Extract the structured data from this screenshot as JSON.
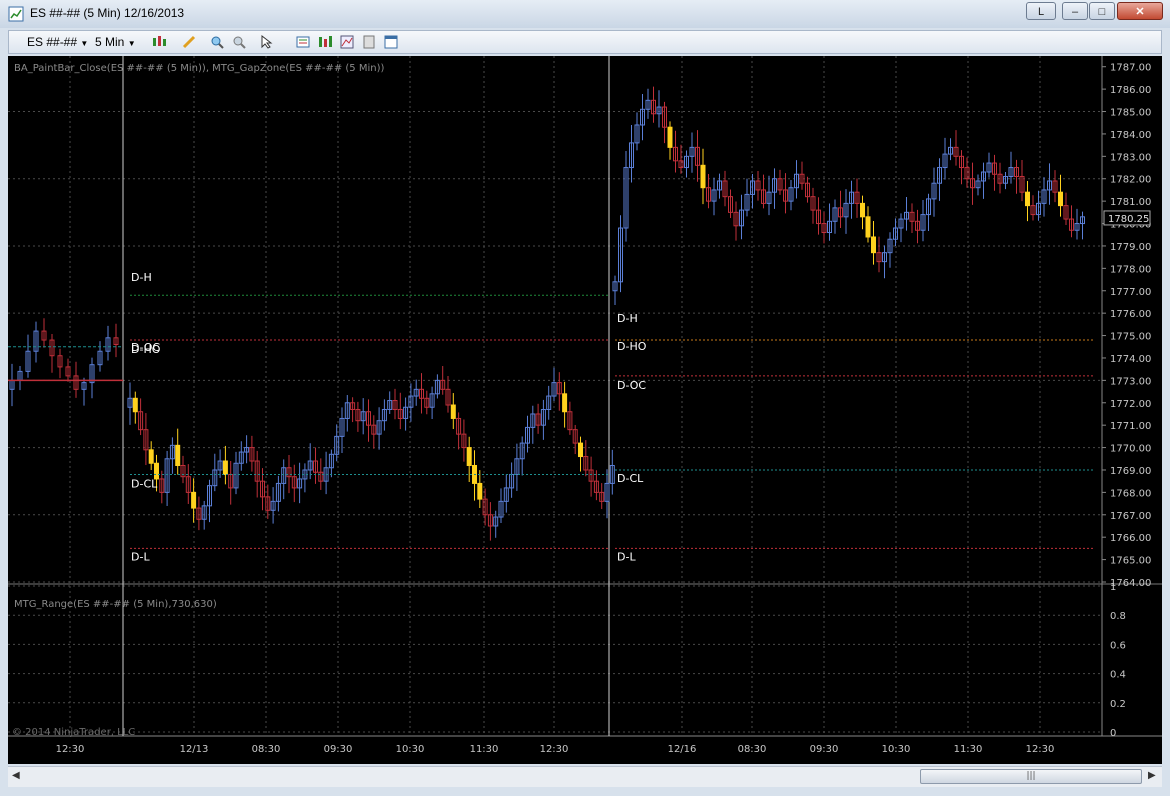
{
  "window": {
    "title": "ES ##-## (5 Min)  12/16/2013",
    "buttons": {
      "layout": "L",
      "minimize": "–",
      "maximize": "□",
      "close": "✕"
    }
  },
  "toolbar": {
    "instrument": "ES ##-##",
    "interval": "5 Min",
    "icons": [
      "candlestick-style-icon",
      "drawing-pencil-icon",
      "zoom-in-icon",
      "zoom-out-icon",
      "cursor-pointer-icon",
      "data-box-icon",
      "indicators-icon",
      "strategies-icon",
      "chart-trader-icon",
      "properties-icon"
    ]
  },
  "colors": {
    "background": "#000000",
    "grid": "#4a4a4a",
    "up_bar": "#5b7fd6",
    "down_bar": "#c0303a",
    "paint_bar": "#ffd21e",
    "doji_bar": "#ffffff",
    "zone_dh": "#1f8a3a",
    "zone_dho": "#c87a1a",
    "zone_doc": "#c0303a",
    "zone_dcl": "#1e8f8f",
    "zone_dl": "#c0303a",
    "axis_text": "#c8c8c8",
    "label_text": "#ffffff"
  },
  "price_panel": {
    "indicator_label": "BA_PaintBar_Close(ES ##-## (5 Min)),  MTG_GapZone(ES ##-## (5 Min))",
    "y_axis_ticks": [
      "1787.00",
      "1786.00",
      "1785.00",
      "1784.00",
      "1783.00",
      "1782.00",
      "1781.00",
      "1780.00",
      "1779.00",
      "1778.00",
      "1777.00",
      "1776.00",
      "1775.00",
      "1774.00",
      "1773.00",
      "1772.00",
      "1771.00",
      "1770.00",
      "1769.00",
      "1768.00",
      "1767.00",
      "1766.00",
      "1765.00",
      "1764.00"
    ],
    "last_price": "1780.25",
    "zone_labels_session1": [
      "D-H",
      "D-HO",
      "D-OC",
      "D-CL",
      "D-L"
    ],
    "zone_labels_session2": [
      "D-H",
      "D-HO",
      "D-OC",
      "D-CL",
      "D-L"
    ],
    "zones_session1": {
      "D-H": 1776.8,
      "D-HO": 1774.8,
      "D-OC": 1774.8,
      "D-CL": 1768.8,
      "D-L": 1765.5
    },
    "zones_session2": {
      "D-H": 1774.8,
      "D-HO": 1774.8,
      "D-OC": 1773.2,
      "D-CL": 1769.0,
      "D-L": 1765.5
    },
    "prior_zones": {
      "teal": 1774.5,
      "red": 1773.0
    }
  },
  "range_panel": {
    "indicator_label": "MTG_Range(ES ##-## (5 Min),730,630)",
    "y_axis_ticks": [
      "1",
      "0.8",
      "0.6",
      "0.4",
      "0.2",
      "0"
    ]
  },
  "x_axis_ticks": [
    "12:30",
    "12/13",
    "08:30",
    "09:30",
    "10:30",
    "11:30",
    "12:30",
    "12/16",
    "08:30",
    "09:30",
    "10:30",
    "11:30",
    "12:30"
  ],
  "copyright": "© 2014 NinjaTrader, LLC",
  "chart_data": {
    "type": "candlestick",
    "ylim": [
      1764,
      1787.3
    ],
    "x_ticks": [
      "12:30",
      "12/13",
      "08:30",
      "09:30",
      "10:30",
      "11:30",
      "12:30",
      "12/16",
      "08:30",
      "09:30",
      "10:30",
      "11:30",
      "12:30"
    ],
    "session_breaks": [
      "12/13",
      "12/16"
    ],
    "closes_session_prev": [
      1773.0,
      1773.4,
      1774.3,
      1775.2,
      1774.8,
      1774.1,
      1773.6,
      1773.2,
      1772.6,
      1772.9,
      1773.7,
      1774.3,
      1774.9,
      1774.6
    ],
    "closes_session1": [
      1772.2,
      1771.6,
      1770.8,
      1769.9,
      1769.3,
      1768.6,
      1768.0,
      1769.5,
      1770.1,
      1769.2,
      1768.7,
      1768.0,
      1767.3,
      1766.8,
      1767.4,
      1768.3,
      1769.0,
      1769.4,
      1768.8,
      1768.2,
      1769.3,
      1769.8,
      1770.0,
      1769.4,
      1768.5,
      1767.8,
      1767.2,
      1767.6,
      1768.4,
      1769.1,
      1768.7,
      1768.2,
      1768.6,
      1769.0,
      1769.4,
      1768.9,
      1768.5,
      1769.1,
      1769.7,
      1770.5,
      1771.3,
      1772.0,
      1771.7,
      1771.2,
      1771.6,
      1771.0,
      1770.6,
      1771.2,
      1771.7,
      1772.1,
      1771.7,
      1771.3,
      1771.8,
      1772.3,
      1772.6,
      1772.2,
      1771.8,
      1772.4,
      1773.0,
      1772.6,
      1771.9,
      1771.3,
      1770.6,
      1770.0,
      1769.2,
      1768.4,
      1767.7,
      1767.0,
      1766.5,
      1766.9,
      1767.6,
      1768.2,
      1768.8,
      1769.5,
      1770.2,
      1770.9,
      1771.5,
      1771.0,
      1771.7,
      1772.3,
      1772.9,
      1772.4,
      1771.6,
      1770.8,
      1770.2,
      1769.6,
      1769.0,
      1768.5,
      1768.0,
      1767.6,
      1768.4,
      1769.2
    ],
    "closes_session2": [
      1777.4,
      1779.8,
      1782.5,
      1783.6,
      1784.4,
      1785.1,
      1785.5,
      1784.9,
      1785.2,
      1784.3,
      1783.4,
      1782.8,
      1782.5,
      1783.0,
      1783.4,
      1782.6,
      1781.6,
      1781.0,
      1781.5,
      1781.9,
      1781.2,
      1780.5,
      1779.9,
      1780.6,
      1781.3,
      1781.9,
      1781.5,
      1780.9,
      1781.4,
      1782.0,
      1781.5,
      1781.0,
      1781.6,
      1782.2,
      1781.8,
      1781.2,
      1780.6,
      1780.0,
      1779.6,
      1780.1,
      1780.7,
      1780.3,
      1780.9,
      1781.4,
      1780.9,
      1780.3,
      1779.4,
      1778.7,
      1778.3,
      1778.7,
      1779.3,
      1779.8,
      1780.2,
      1780.5,
      1780.1,
      1779.7,
      1780.4,
      1781.1,
      1781.8,
      1782.5,
      1783.1,
      1783.4,
      1783.0,
      1782.5,
      1782.0,
      1781.6,
      1781.9,
      1782.3,
      1782.7,
      1782.2,
      1781.8,
      1782.1,
      1782.5,
      1782.1,
      1781.4,
      1780.8,
      1780.4,
      1780.9,
      1781.5,
      1781.9,
      1781.4,
      1780.8,
      1780.2,
      1779.7,
      1780.0,
      1780.3
    ]
  }
}
